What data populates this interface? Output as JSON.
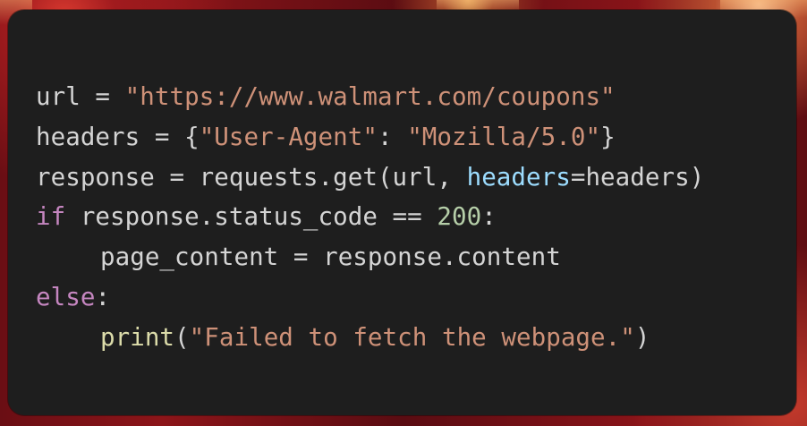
{
  "code": {
    "line1": {
      "var": "url",
      "op": " = ",
      "str": "\"https://www.walmart.com/coupons\""
    },
    "line2": {
      "var": "headers",
      "op": " = {",
      "key": "\"User-Agent\"",
      "colon": ": ",
      "val": "\"Mozilla/5.0\"",
      "close": "}"
    },
    "line3": {
      "pre": "response = requests.get(url, ",
      "param": "headers",
      "post": "=headers)"
    },
    "line4": {
      "kw": "if",
      "mid": " response.status_code == ",
      "num": "200",
      "colon": ":"
    },
    "line5": {
      "text": "page_content = response.content"
    },
    "line6": {
      "kw": "else",
      "colon": ":"
    },
    "line7": {
      "fn": "print",
      "open": "(",
      "str": "\"Failed to fetch the webpage.\"",
      "close": ")"
    }
  },
  "colors": {
    "background": "#1e1e1e",
    "default_text": "#d4d4d4",
    "string": "#ce9178",
    "parameter": "#9cdcfe",
    "keyword": "#c586c0",
    "number": "#b5cea8",
    "function": "#dcdcaa"
  }
}
